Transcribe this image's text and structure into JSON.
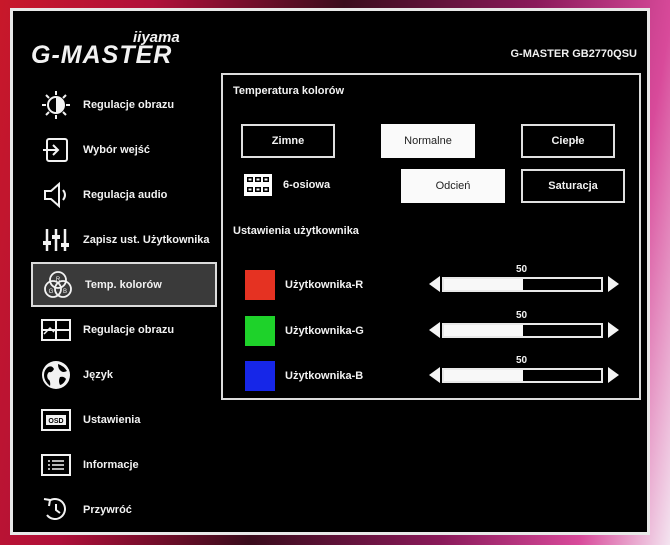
{
  "brand": {
    "maker": "iiyama",
    "line": "G-MASTER"
  },
  "model": "G-MASTER GB2770QSU",
  "menu": [
    {
      "id": "regulacje-obrazu-1",
      "label": "Regulacje obrazu",
      "icon": "brightness-icon"
    },
    {
      "id": "wybor-wejsc",
      "label": "Wybór wejść",
      "icon": "input-icon"
    },
    {
      "id": "regulacja-audio",
      "label": "Regulacja audio",
      "icon": "speaker-icon"
    },
    {
      "id": "zapisz-ust",
      "label": "Zapisz ust. Użytkownika",
      "icon": "sliders-icon"
    },
    {
      "id": "temp-kolorow",
      "label": "Temp. kolorów",
      "icon": "rgb-icon",
      "active": true
    },
    {
      "id": "regulacje-obrazu-2",
      "label": "Regulacje obrazu",
      "icon": "picture-icon"
    },
    {
      "id": "jezyk",
      "label": "Język",
      "icon": "globe-icon"
    },
    {
      "id": "ustawienia",
      "label": "Ustawienia",
      "icon": "osd-icon"
    },
    {
      "id": "informacje",
      "label": "Informacje",
      "icon": "info-icon"
    },
    {
      "id": "przywroc",
      "label": "Przywróć",
      "icon": "reset-icon"
    }
  ],
  "panel": {
    "title": "Temperatura kolorów",
    "presets": [
      "Zimne",
      "Normalne",
      "Ciepłe"
    ],
    "selected_preset": "Normalne",
    "six_axis_label": "6-osiowa",
    "six_axis_buttons": [
      "Odcień",
      "Saturacja"
    ],
    "user_section_title": "Ustawienia użytkownika",
    "channels": [
      {
        "label": "Użytkownika-R",
        "value": "50",
        "level": 0.5,
        "color": "#e53222"
      },
      {
        "label": "Użytkownika-G",
        "value": "50",
        "level": 0.5,
        "color": "#1ed22a"
      },
      {
        "label": "Użytkownika-B",
        "value": "50",
        "level": 0.5,
        "color": "#1626e8"
      }
    ]
  }
}
